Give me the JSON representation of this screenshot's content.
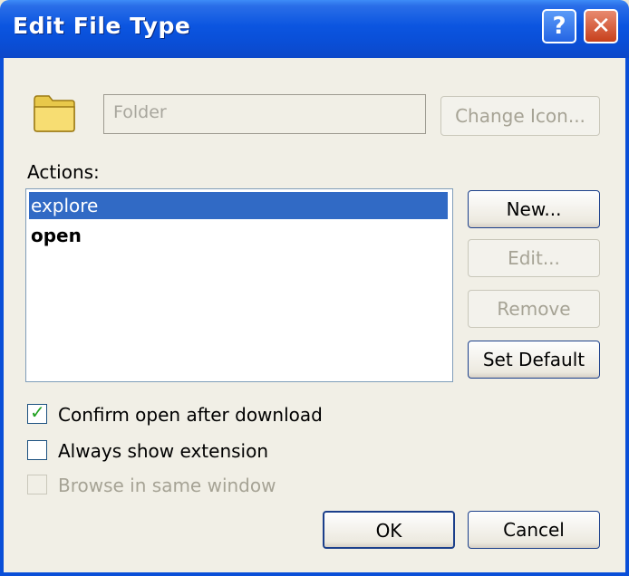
{
  "window": {
    "title": "Edit File Type"
  },
  "titlebar": {
    "help_glyph": "?",
    "close_glyph": "✕"
  },
  "icon_name": "folder-icon",
  "file_type": {
    "description_value": "Folder",
    "change_icon_label": "Change Icon..."
  },
  "actions": {
    "label": "Actions:",
    "items": [
      {
        "label": "explore",
        "selected": true,
        "default": false
      },
      {
        "label": "open",
        "selected": false,
        "default": true
      }
    ]
  },
  "buttons": {
    "new": "New...",
    "edit": "Edit...",
    "remove": "Remove",
    "set_default": "Set Default",
    "ok": "OK",
    "cancel": "Cancel"
  },
  "options": {
    "confirm_open": {
      "label": "Confirm open after download",
      "checked": true,
      "enabled": true
    },
    "always_show_ext": {
      "label": "Always show extension",
      "checked": false,
      "enabled": true
    },
    "browse_same_window": {
      "label": "Browse in same window",
      "checked": false,
      "enabled": false
    }
  },
  "colors": {
    "titlebar": "#0a4fd8",
    "selection": "#316ac5",
    "dialog_bg": "#f1efe6"
  }
}
